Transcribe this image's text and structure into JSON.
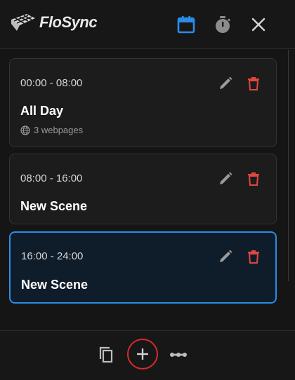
{
  "app": {
    "name": "FloSync"
  },
  "header": {
    "calendar_icon": "calendar-icon",
    "timer_icon": "stopwatch-icon",
    "close_icon": "close-icon",
    "accent_color": "#2a8de8"
  },
  "scenes": [
    {
      "time": "00:00 - 08:00",
      "name": "All Day",
      "meta": "3 webpages",
      "selected": false
    },
    {
      "time": "08:00 - 16:00",
      "name": "New Scene",
      "meta": "",
      "selected": false
    },
    {
      "time": "16:00 - 24:00",
      "name": "New Scene",
      "meta": "",
      "selected": true
    }
  ],
  "card_actions": {
    "edit_icon": "pencil-icon",
    "delete_icon": "trash-icon",
    "delete_color": "#e0473f"
  },
  "footer": {
    "copy_icon": "copy-icon",
    "add_icon": "plus-icon",
    "more_icon": "more-horizontal-icon",
    "add_highlight_color": "#d62b2b"
  }
}
